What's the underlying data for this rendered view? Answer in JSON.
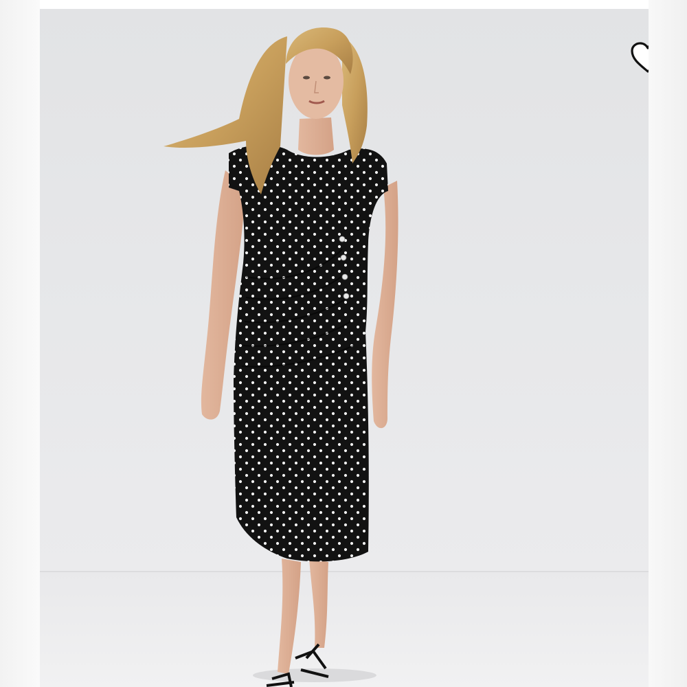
{
  "product_image": {
    "subject": "polka-dot-midi-dress-model",
    "background_color": "#e4e5e7",
    "dress_color": "#111111",
    "dot_color": "#f4f4f4"
  },
  "favorite_button": {
    "icon": "heart-outline-icon",
    "state": "not-favorited",
    "stroke_color": "#111111",
    "fill_color": "#ffffff"
  }
}
